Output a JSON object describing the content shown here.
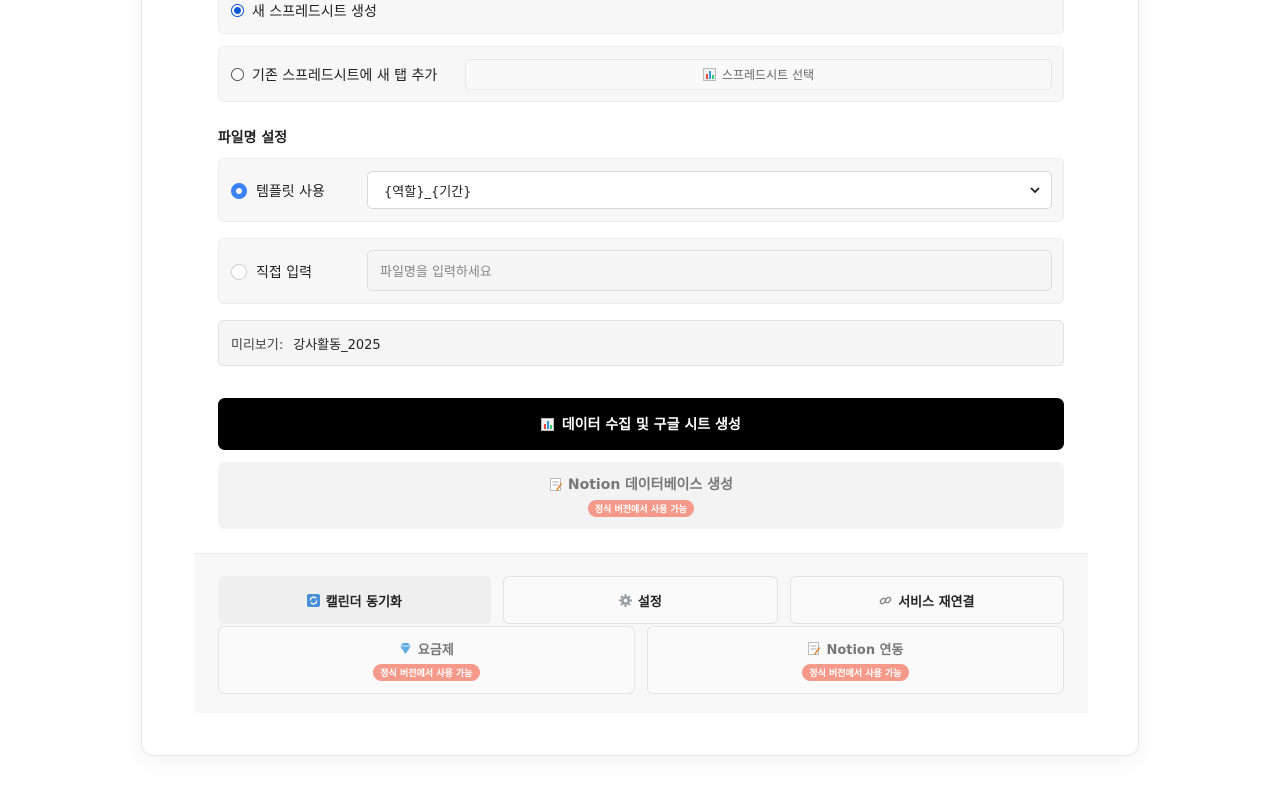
{
  "sheet_options": {
    "new_sheet_label": "새 스프레드시트 생성",
    "existing_sheet_label": "기존 스프레드시트에 새 탭 추가",
    "select_sheet_button": "스프레드시트 선택"
  },
  "filename": {
    "section_title": "파일명 설정",
    "template_label": "템플릿 사용",
    "template_value": "{역할}_{기간}",
    "custom_label": "직접 입력",
    "custom_placeholder": "파일명을 입력하세요",
    "preview_label": "미리보기:",
    "preview_value": "강사활동_2025"
  },
  "actions": {
    "collect_button": "데이터 수집 및 구글 시트 생성",
    "notion_db_button": "Notion 데이터베이스 생성",
    "notion_db_badge": "정식 버전에서 사용 가능"
  },
  "footer": {
    "calendar_sync": "캘린더 동기화",
    "settings": "설정",
    "reconnect": "서비스 재연결",
    "pricing": "요금제",
    "pricing_badge": "정식 버전에서 사용 가능",
    "notion_link": "Notion 연동",
    "notion_link_badge": "정식 버전에서 사용 가능"
  },
  "colors": {
    "accent": "#3b82f6",
    "primary_button": "#000000",
    "badge": "#f59a8a"
  },
  "icons": {
    "chart": "chart-icon",
    "memo": "memo-icon",
    "sync": "sync-icon",
    "gear": "gear-icon",
    "link": "link-icon",
    "gem": "gem-icon"
  }
}
